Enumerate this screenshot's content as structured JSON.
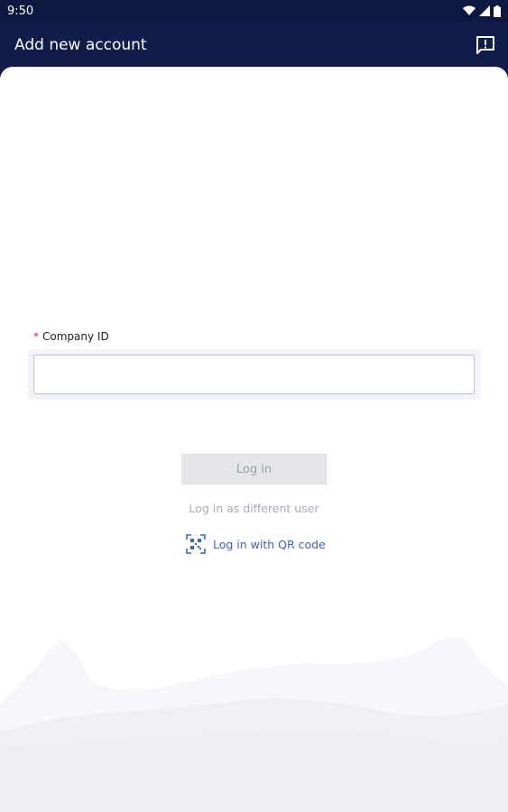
{
  "status_bar": {
    "time": "9:50",
    "icons": [
      "wifi-icon",
      "cellular-icon",
      "battery-icon"
    ]
  },
  "app_bar": {
    "title": "Add new account",
    "action_icon": "feedback-icon"
  },
  "form": {
    "company_id": {
      "required_mark": "*",
      "label": "Company ID",
      "value": "",
      "placeholder": ""
    },
    "login_button": "Log in",
    "different_user_link": "Log in as different user",
    "qr_link": "Log in with QR code",
    "qr_icon": "qr-code-scan-icon"
  },
  "colors": {
    "header": "#101c4a",
    "link": "#3a66c4",
    "disabled_button": "#e4e6ea",
    "required": "#d8241f"
  }
}
